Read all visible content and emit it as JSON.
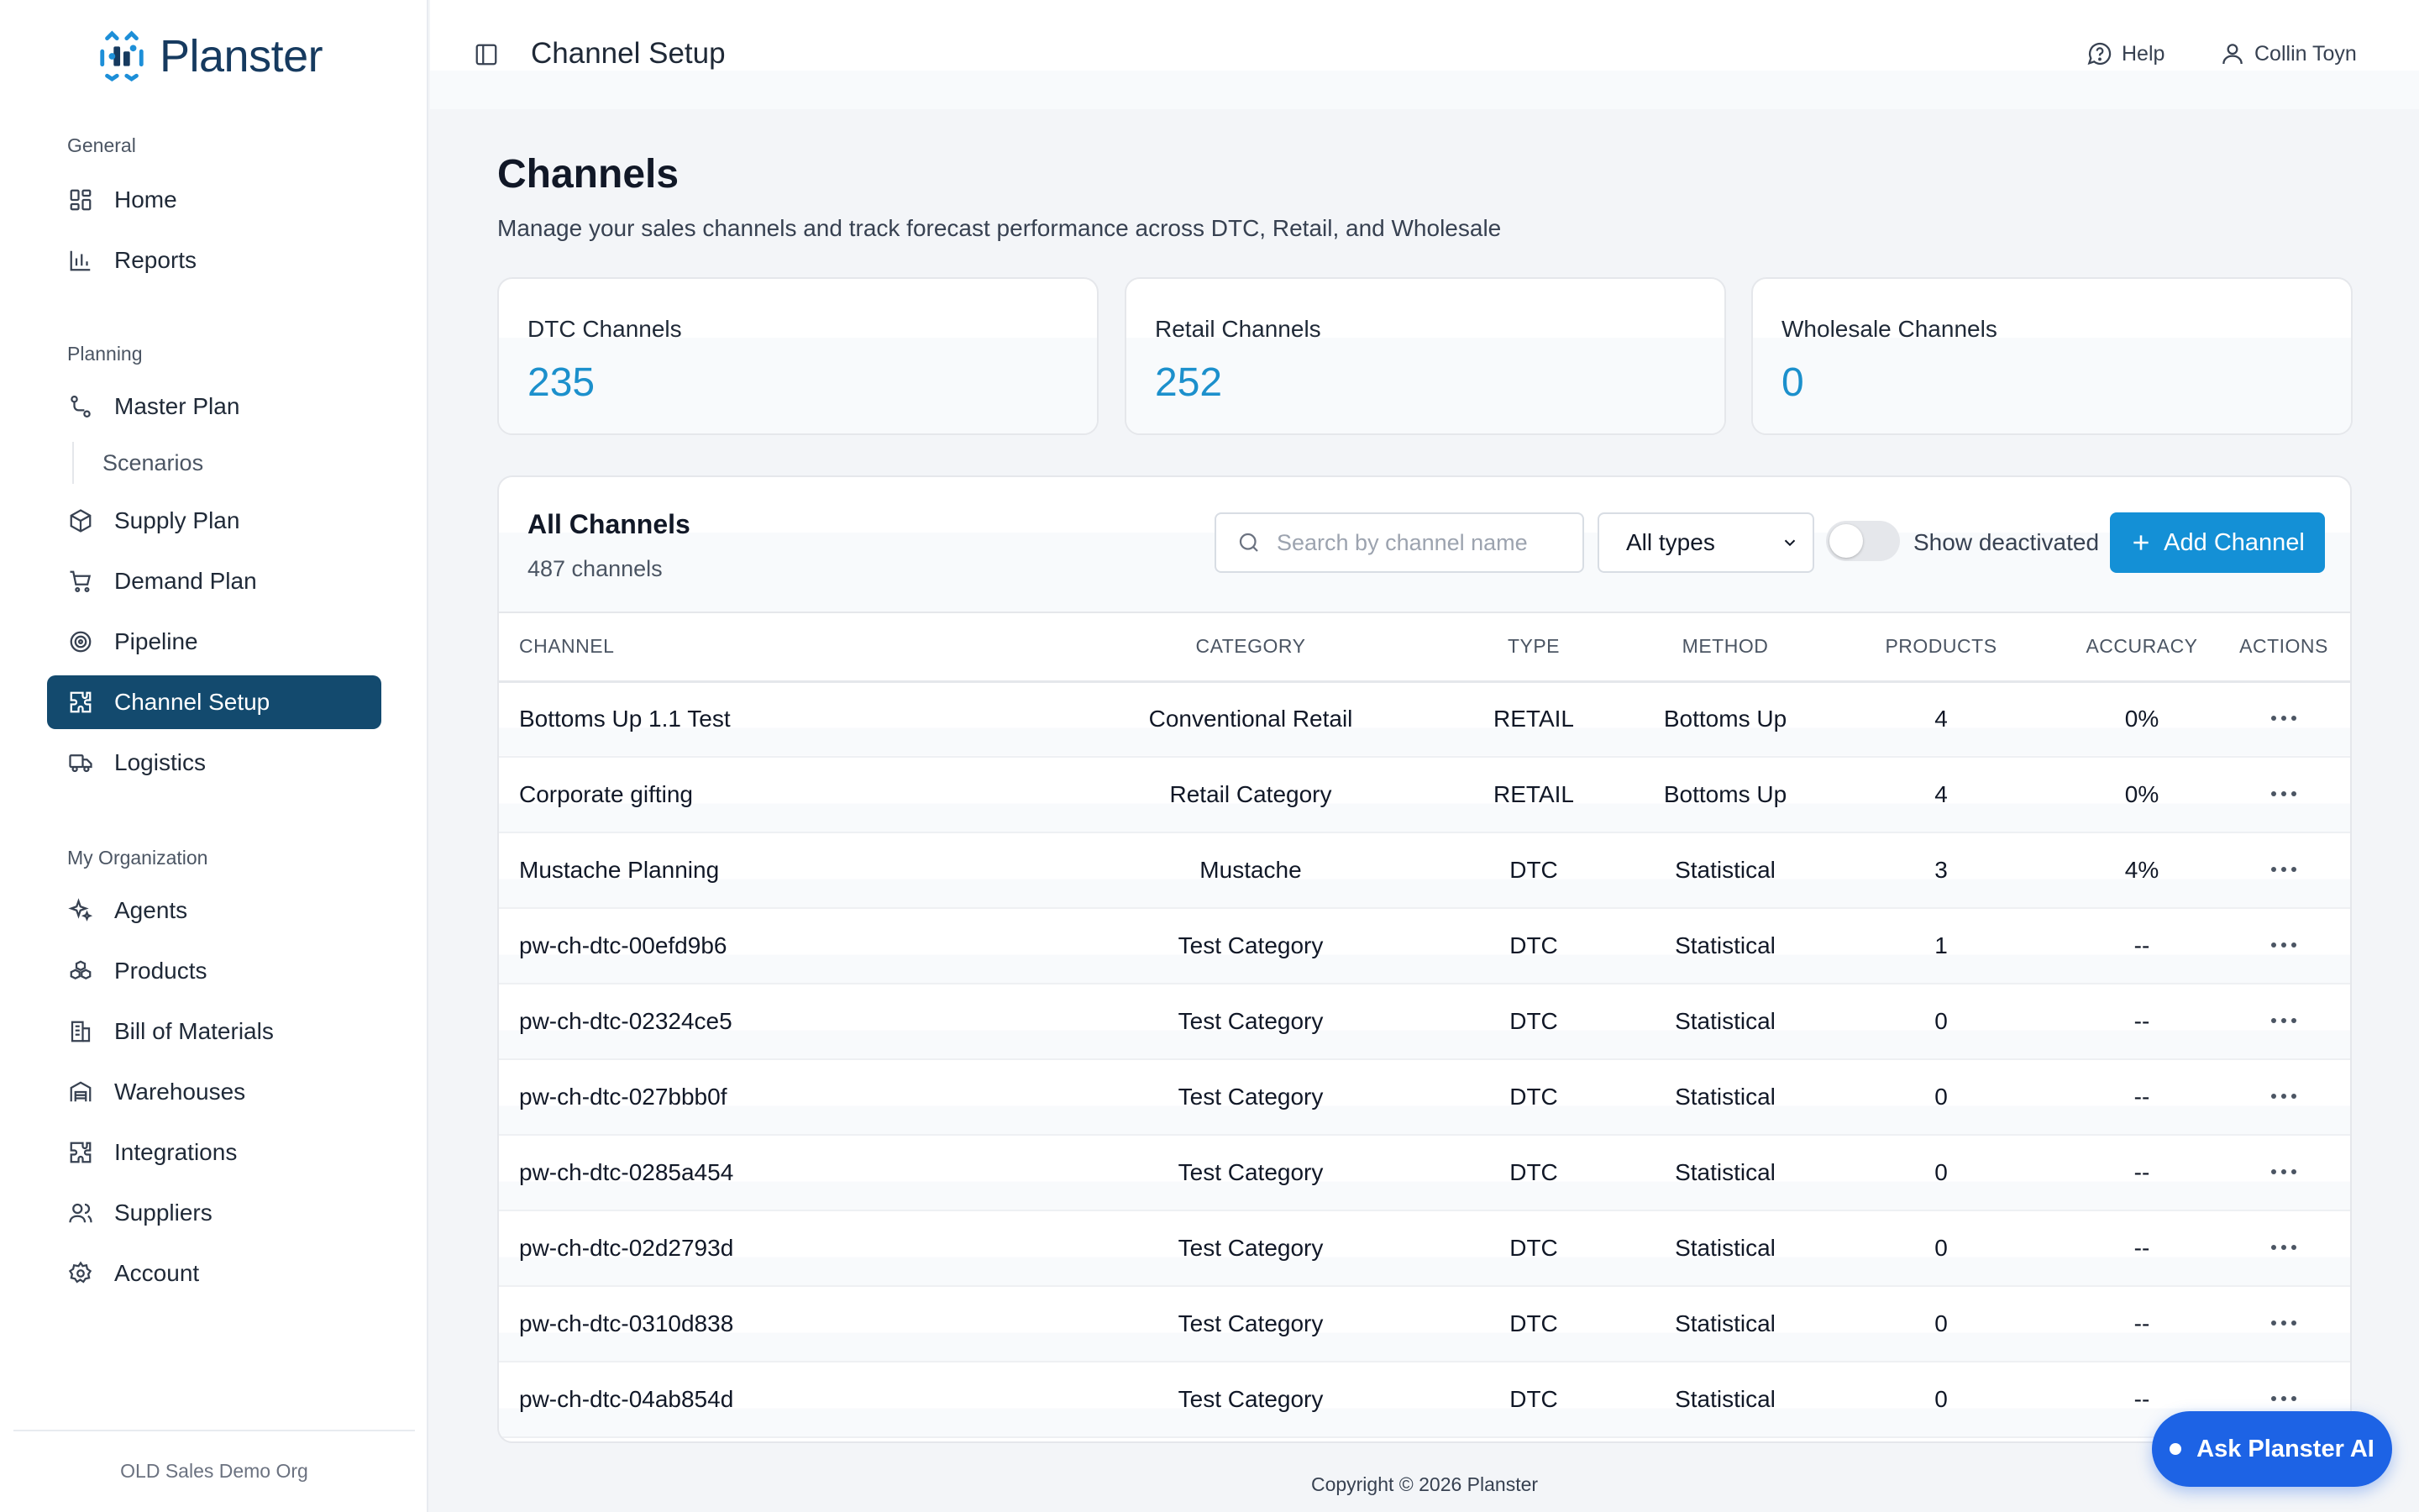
{
  "app": {
    "name": "Planster",
    "org_name": "OLD Sales Demo Org",
    "copyright": "Copyright © 2026 Planster"
  },
  "colors": {
    "brand": "#163a5f",
    "active_nav": "#134a6e",
    "accent": "#1490d6",
    "stat_value": "#1c90cc",
    "ask_ai": "#1d63e5"
  },
  "sidebar": {
    "sections": [
      {
        "title": "General"
      },
      {
        "title": "Planning"
      },
      {
        "title": "My Organization"
      }
    ],
    "items": [
      {
        "label": "Home",
        "icon": "dashboard-grid-icon"
      },
      {
        "label": "Reports",
        "icon": "bar-chart-icon"
      },
      {
        "label": "Master Plan",
        "icon": "route-icon"
      },
      {
        "label": "Scenarios",
        "icon": ""
      },
      {
        "label": "Supply Plan",
        "icon": "package-icon"
      },
      {
        "label": "Demand Plan",
        "icon": "shopping-cart-icon"
      },
      {
        "label": "Pipeline",
        "icon": "target-icon"
      },
      {
        "label": "Channel Setup",
        "icon": "puzzle-icon",
        "active": true
      },
      {
        "label": "Logistics",
        "icon": "truck-icon"
      },
      {
        "label": "Agents",
        "icon": "sparkles-icon"
      },
      {
        "label": "Products",
        "icon": "boxes-icon"
      },
      {
        "label": "Bill of Materials",
        "icon": "building-icon"
      },
      {
        "label": "Warehouses",
        "icon": "warehouse-icon"
      },
      {
        "label": "Integrations",
        "icon": "puzzle-icon"
      },
      {
        "label": "Suppliers",
        "icon": "users-icon"
      },
      {
        "label": "Account",
        "icon": "gear-icon"
      }
    ]
  },
  "topbar": {
    "page": "Channel Setup",
    "help_label": "Help",
    "user_name": "Collin Toyn"
  },
  "main": {
    "title": "Channels",
    "subtitle": "Manage your sales channels and track forecast performance across DTC, Retail, and Wholesale",
    "stats": [
      {
        "label": "DTC Channels",
        "value": "235"
      },
      {
        "label": "Retail Channels",
        "value": "252"
      },
      {
        "label": "Wholesale Channels",
        "value": "0"
      }
    ]
  },
  "table": {
    "title": "All Channels",
    "count": "487 channels",
    "search_placeholder": "Search by channel name",
    "type_filter": "All types",
    "show_deactivated_label": "Show deactivated",
    "show_deactivated": false,
    "add_label": "Add Channel",
    "columns": [
      "Channel",
      "Category",
      "Type",
      "Method",
      "Products",
      "Accuracy",
      "Actions"
    ],
    "rows": [
      {
        "channel": "Bottoms Up 1.1 Test",
        "category": "Conventional Retail",
        "type": "RETAIL",
        "method": "Bottoms Up",
        "products": "4",
        "accuracy": "0%"
      },
      {
        "channel": "Corporate gifting",
        "category": "Retail Category",
        "type": "RETAIL",
        "method": "Bottoms Up",
        "products": "4",
        "accuracy": "0%"
      },
      {
        "channel": "Mustache Planning",
        "category": "Mustache",
        "type": "DTC",
        "method": "Statistical",
        "products": "3",
        "accuracy": "4%"
      },
      {
        "channel": "pw-ch-dtc-00efd9b6",
        "category": "Test Category",
        "type": "DTC",
        "method": "Statistical",
        "products": "1",
        "accuracy": "--"
      },
      {
        "channel": "pw-ch-dtc-02324ce5",
        "category": "Test Category",
        "type": "DTC",
        "method": "Statistical",
        "products": "0",
        "accuracy": "--"
      },
      {
        "channel": "pw-ch-dtc-027bbb0f",
        "category": "Test Category",
        "type": "DTC",
        "method": "Statistical",
        "products": "0",
        "accuracy": "--"
      },
      {
        "channel": "pw-ch-dtc-0285a454",
        "category": "Test Category",
        "type": "DTC",
        "method": "Statistical",
        "products": "0",
        "accuracy": "--"
      },
      {
        "channel": "pw-ch-dtc-02d2793d",
        "category": "Test Category",
        "type": "DTC",
        "method": "Statistical",
        "products": "0",
        "accuracy": "--"
      },
      {
        "channel": "pw-ch-dtc-0310d838",
        "category": "Test Category",
        "type": "DTC",
        "method": "Statistical",
        "products": "0",
        "accuracy": "--"
      },
      {
        "channel": "pw-ch-dtc-04ab854d",
        "category": "Test Category",
        "type": "DTC",
        "method": "Statistical",
        "products": "0",
        "accuracy": "--"
      }
    ]
  },
  "ask_ai": {
    "label": "Ask Planster AI"
  }
}
